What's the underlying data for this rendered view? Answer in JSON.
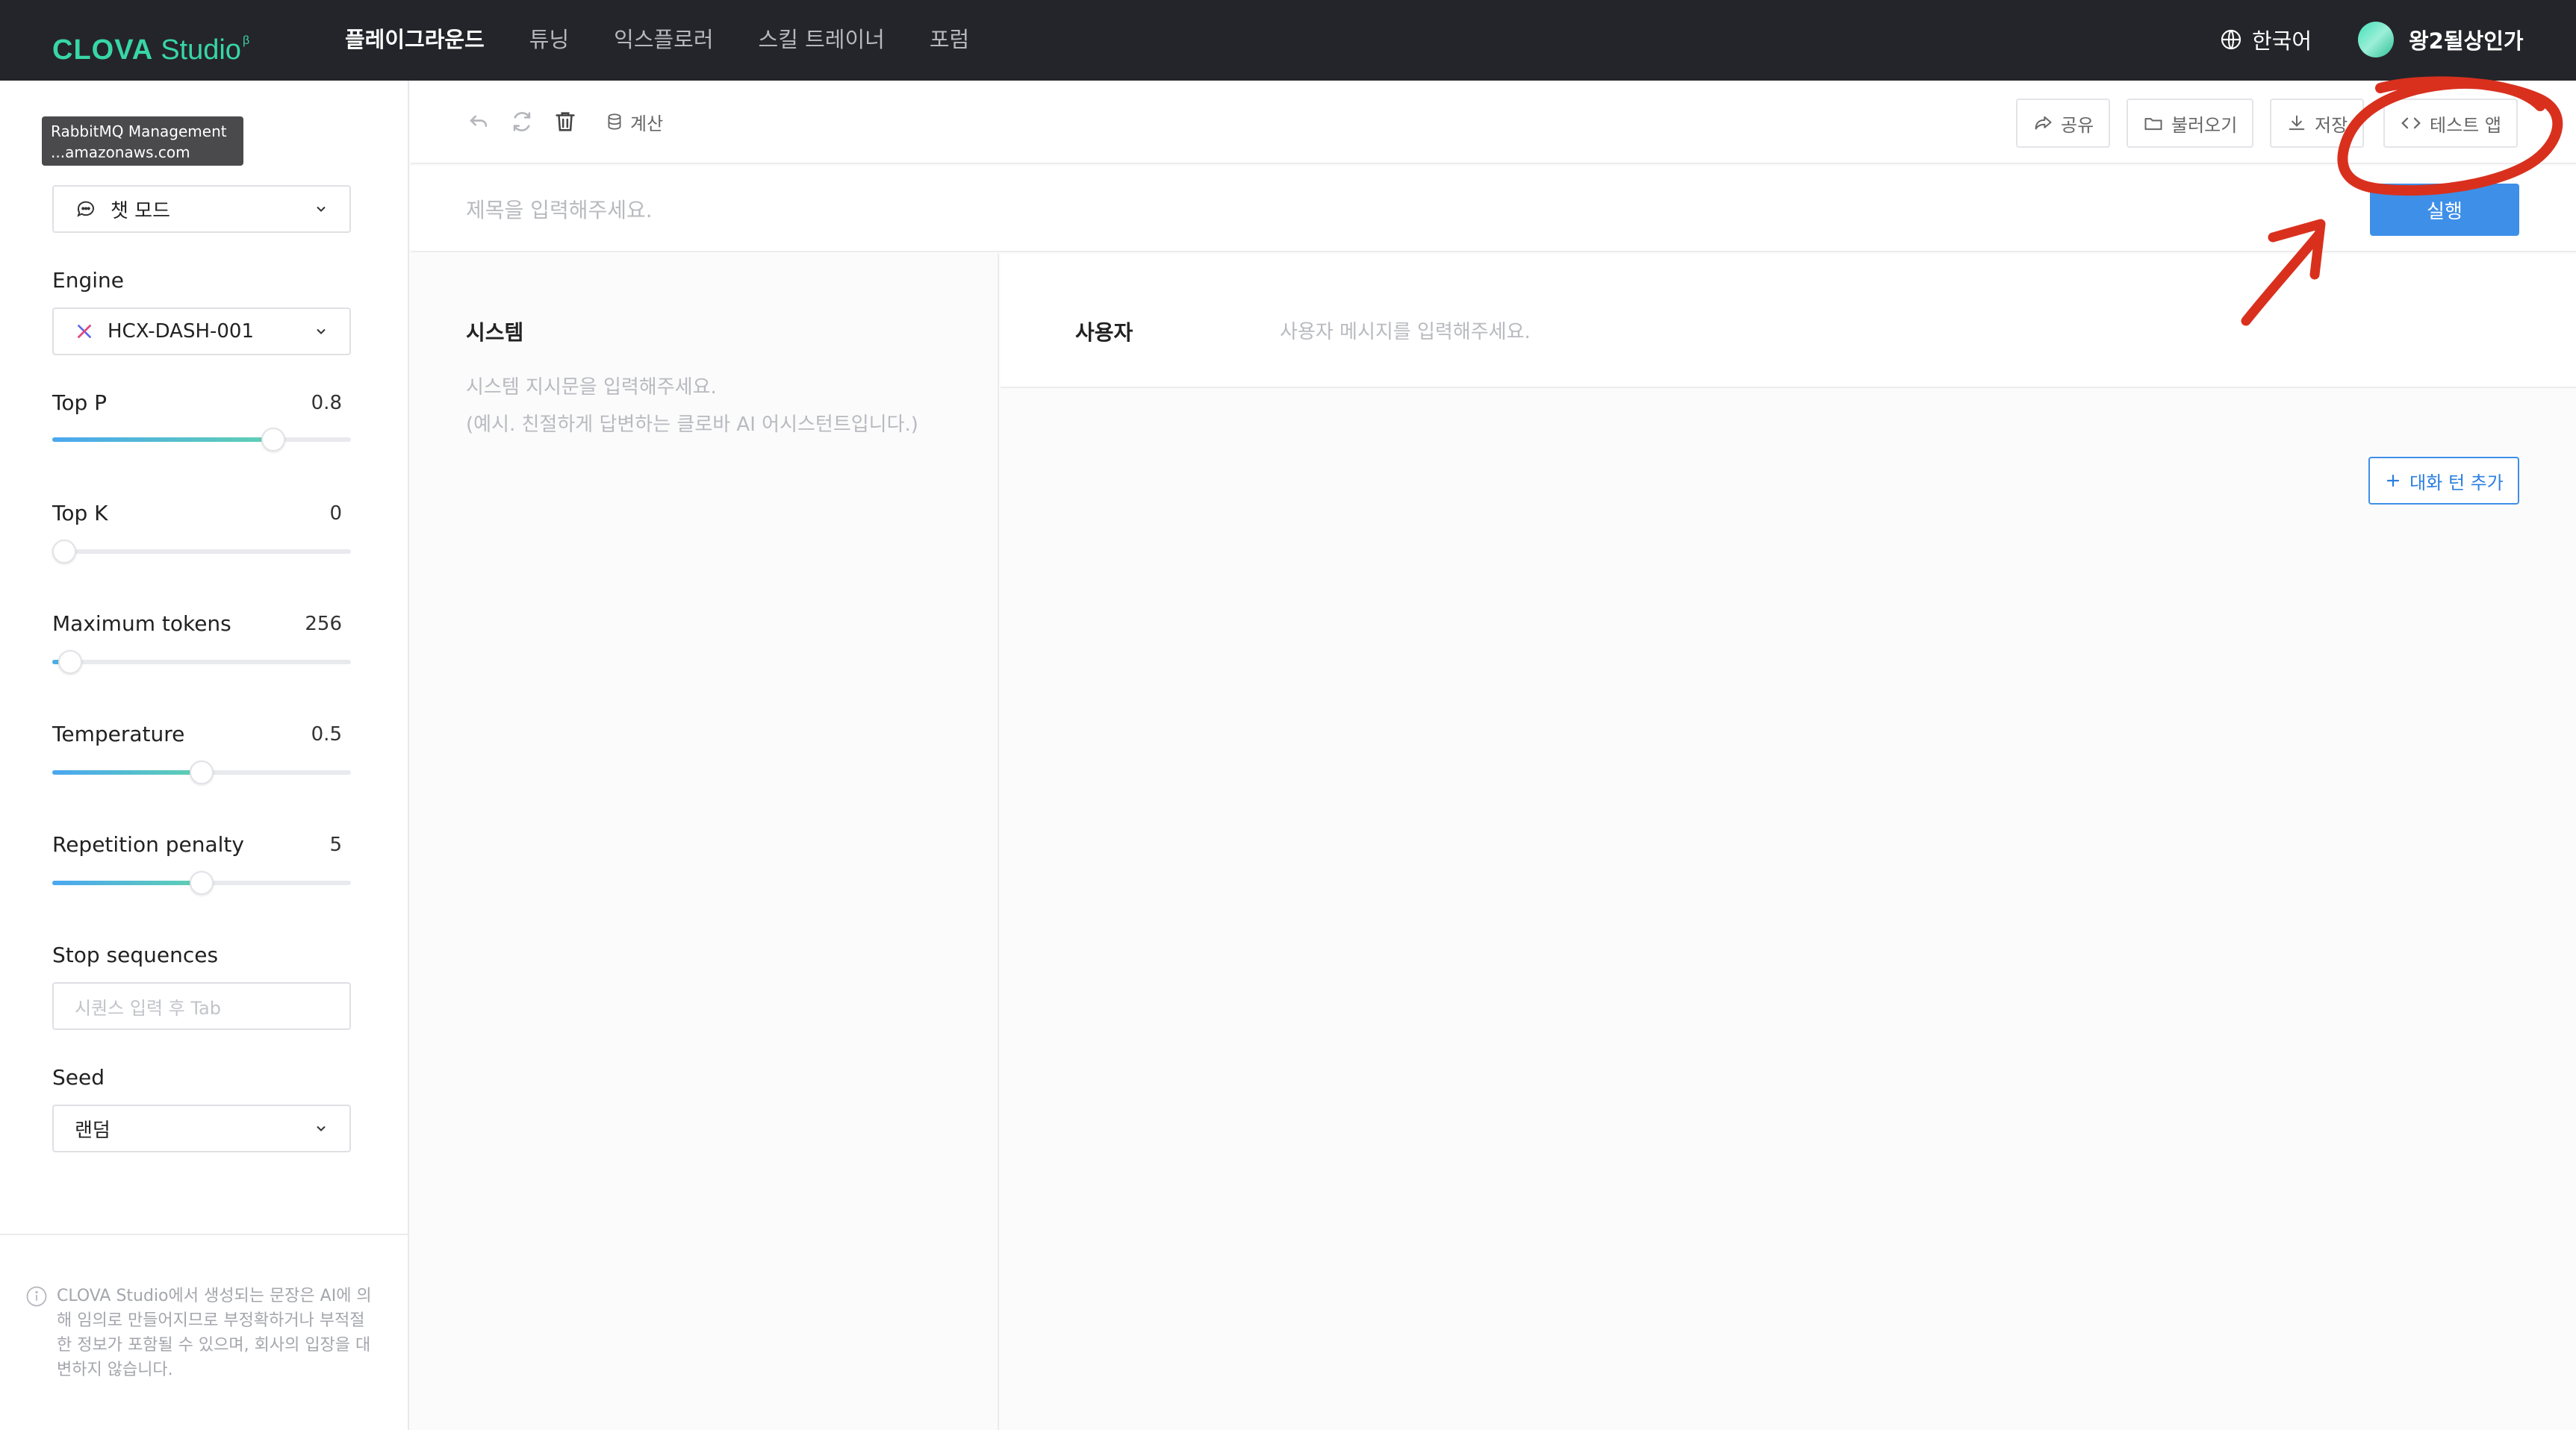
{
  "topbar": {
    "logo_main": "CLOVA",
    "logo_sub": "Studio",
    "logo_sup": "β",
    "nav": [
      "플레이그라운드",
      "튜닝",
      "익스플로러",
      "스킬 트레이너",
      "포럼"
    ],
    "active_nav": "플레이그라운드",
    "language": "한국어",
    "user_name": "왕2될상인가"
  },
  "tooltip": {
    "line1": "RabbitMQ Management",
    "line2": "...amazonaws.com"
  },
  "sidebar": {
    "mode": "챗 모드",
    "engine_label": "Engine",
    "engine_value": "HCX-DASH-001",
    "params": [
      {
        "label": "Top P",
        "value": "0.8",
        "level": 0.74
      },
      {
        "label": "Top K",
        "value": "0",
        "level": 0.0
      },
      {
        "label": "Maximum tokens",
        "value": "256",
        "level": 0.06
      },
      {
        "label": "Temperature",
        "value": "0.5",
        "level": 0.5
      },
      {
        "label": "Repetition penalty",
        "value": "5",
        "level": 0.5
      }
    ],
    "stop_label": "Stop sequences",
    "stop_placeholder": "시퀀스 입력 후 Tab",
    "seed_label": "Seed",
    "seed_value": "랜덤",
    "notice": "CLOVA Studio에서 생성되는 문장은 AI에 의해 임의로 만들어지므로 부정확하거나 부적절한 정보가 포함될 수 있으며, 회사의 입장을 대변하지 않습니다."
  },
  "toolbar": {
    "calc_label": "계산",
    "share_label": "공유",
    "load_label": "불러오기",
    "save_label": "저장",
    "test_app_label": "테스트 앱"
  },
  "title_row": {
    "placeholder": "제목을 입력해주세요.",
    "run_label": "실행"
  },
  "system": {
    "title": "시스템",
    "placeholder_line1": "시스템 지시문을 입력해주세요.",
    "placeholder_line2": "(예시. 친절하게 답변하는 클로바 AI 어시스턴트입니다.)"
  },
  "user": {
    "role": "사용자",
    "placeholder": "사용자 메시지를 입력해주세요.",
    "add_turn_label": "대화 턴 추가"
  },
  "colors": {
    "topbar_bg": "#24252a",
    "brand": "#38d6a7",
    "accent": "#3e8fe8",
    "annotation": "#d9301e"
  }
}
